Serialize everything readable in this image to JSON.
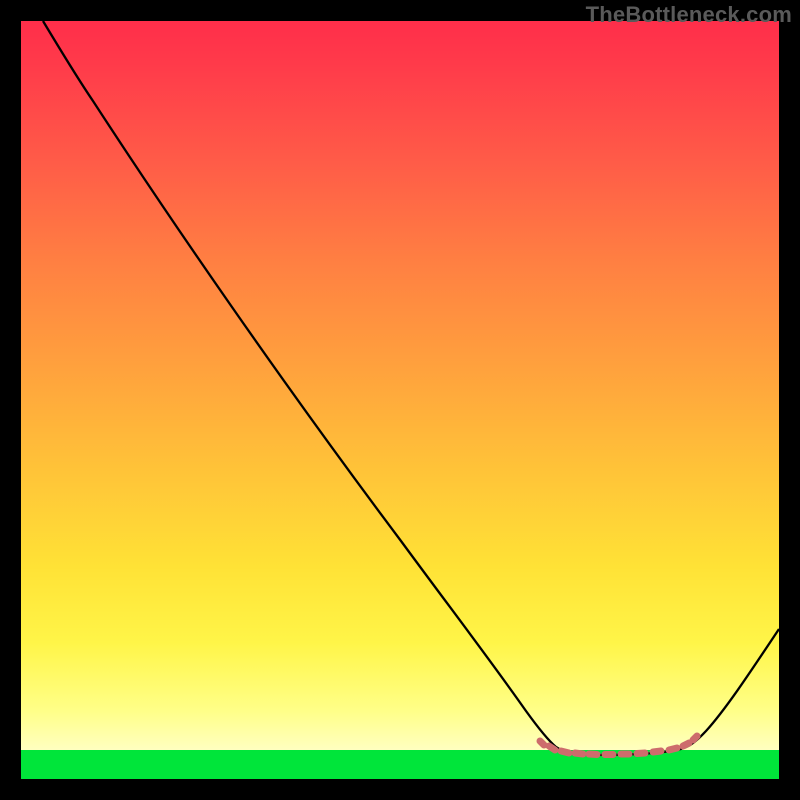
{
  "attribution": "TheBottleneck.com",
  "colors": {
    "background": "#000000",
    "gradient_top": "#ff2e4a",
    "gradient_mid": "#ffe236",
    "gradient_bottom_band": "#00e53a",
    "curve": "#000000",
    "marker": "#cd6c6c"
  },
  "chart_data": {
    "type": "line",
    "title": "",
    "xlabel": "",
    "ylabel": "",
    "xlim": [
      0,
      100
    ],
    "ylim": [
      0,
      100
    ],
    "grid": false,
    "legend": false,
    "series": [
      {
        "name": "curve",
        "x": [
          3,
          6,
          10,
          15,
          20,
          25,
          30,
          35,
          40,
          45,
          50,
          55,
          60,
          64,
          68,
          72,
          76,
          80,
          83,
          86,
          89,
          92,
          95,
          98,
          100
        ],
        "y": [
          100,
          97,
          93,
          88,
          82,
          76,
          69,
          62,
          55,
          48,
          41,
          34,
          27,
          20,
          13,
          7,
          3.8,
          3.5,
          3.5,
          3.5,
          4,
          7,
          12,
          18,
          23
        ]
      },
      {
        "name": "highlight-markers",
        "x": [
          68.5,
          70,
          72,
          74,
          76,
          78,
          80,
          82,
          84,
          86,
          88
        ],
        "y": [
          4.2,
          3.9,
          3.7,
          3.6,
          3.5,
          3.5,
          3.5,
          3.6,
          3.8,
          4.1,
          4.8
        ]
      }
    ],
    "annotations": []
  }
}
